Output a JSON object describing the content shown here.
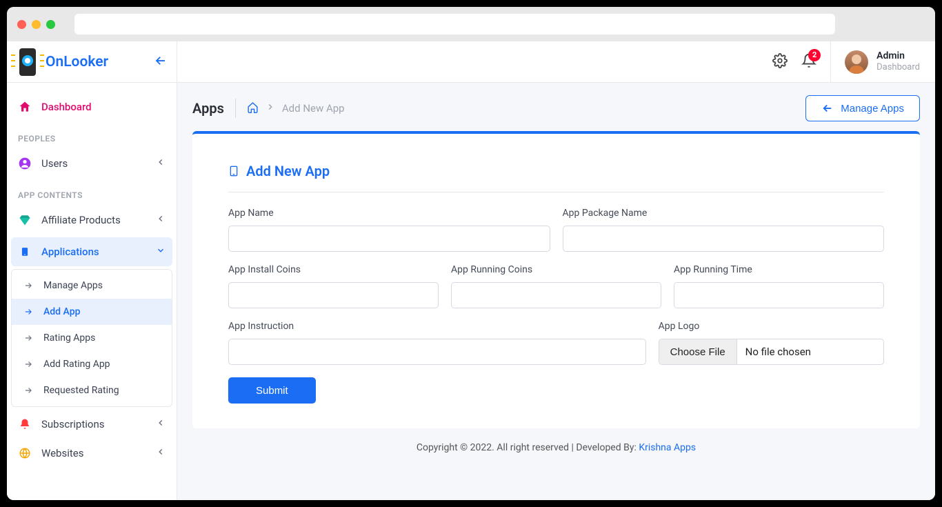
{
  "brand": "OnLooker",
  "sidebar": {
    "dashboard": "Dashboard",
    "section_peoples": "PEOPLES",
    "users": "Users",
    "section_app_contents": "APP CONTENTS",
    "affiliate": "Affiliate Products",
    "applications": "Applications",
    "sub": {
      "manage_apps": "Manage Apps",
      "add_app": "Add App",
      "rating_apps": "Rating Apps",
      "add_rating_app": "Add Rating App",
      "requested_rating": "Requested Rating"
    },
    "subscriptions": "Subscriptions",
    "websites": "Websites"
  },
  "topbar": {
    "badge": "2",
    "user_name": "Admin",
    "user_role": "Dashboard"
  },
  "page": {
    "title": "Apps",
    "crumb": "Add New App",
    "manage_btn": "Manage Apps"
  },
  "form": {
    "card_title": "Add New App",
    "app_name": "App Name",
    "app_package": "App Package Name",
    "install_coins": "App Install Coins",
    "running_coins": "App Running Coins",
    "running_time": "App Running Time",
    "instruction": "App Instruction",
    "logo": "App Logo",
    "choose_file": "Choose File",
    "no_file": "No file chosen",
    "submit": "Submit"
  },
  "footer": {
    "copyright": "Copyright © 2022. All right reserved | Developed By: ",
    "link": "Krishna Apps"
  }
}
